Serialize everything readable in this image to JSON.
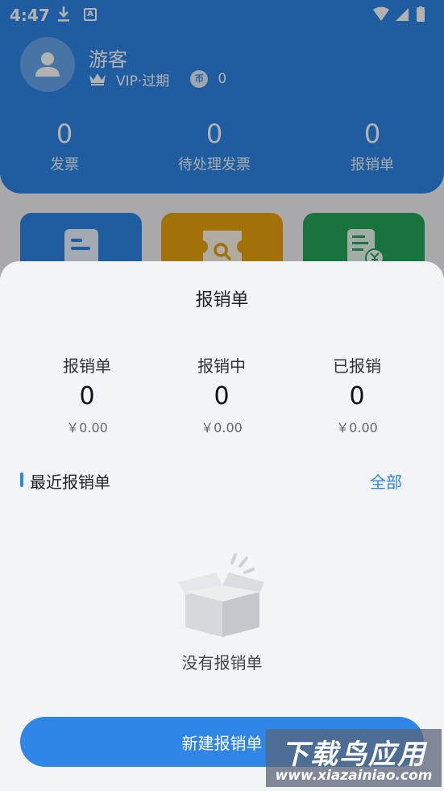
{
  "status_bar": {
    "time": "4:47",
    "notif_letter": "A"
  },
  "profile": {
    "name": "游客",
    "vip": "VIP·过期",
    "coin_label": "币",
    "coins": "0"
  },
  "stats": [
    {
      "value": "0",
      "label": "发票"
    },
    {
      "value": "0",
      "label": "待处理发票"
    },
    {
      "value": "0",
      "label": "报销单"
    }
  ],
  "tiles_colors": [
    "#2f86e6",
    "#e8a20b",
    "#23a55a"
  ],
  "sheet": {
    "title": "报销单",
    "summary": [
      {
        "label": "报销单",
        "count": "0",
        "amount": "￥0.00"
      },
      {
        "label": "报销中",
        "count": "0",
        "amount": "￥0.00"
      },
      {
        "label": "已报销",
        "count": "0",
        "amount": "￥0.00"
      }
    ],
    "recent_title": "最近报销单",
    "all_label": "全部",
    "empty_text": "没有报销单",
    "new_button": "新建报销单"
  },
  "watermark": {
    "main": "下载鸟应用",
    "url": "www.xiazainiao.com"
  },
  "colors": {
    "primary": "#2f86e6",
    "sheet_bg": "#f2f4f8"
  }
}
